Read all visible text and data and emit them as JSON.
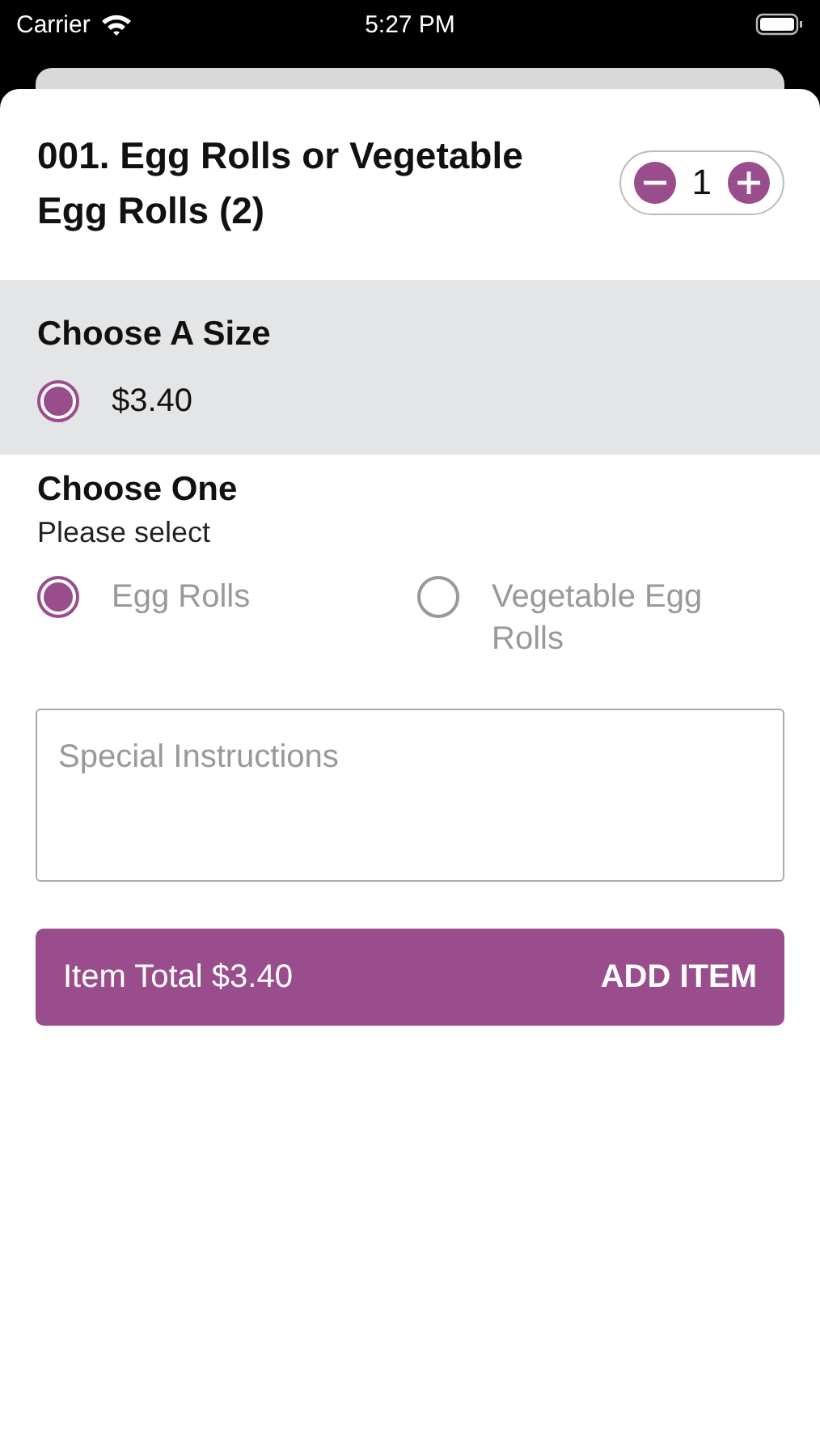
{
  "status_bar": {
    "carrier": "Carrier",
    "time": "5:27 PM"
  },
  "item": {
    "title": "001. Egg Rolls or Vegetable Egg Rolls (2)",
    "quantity": "1"
  },
  "size_section": {
    "heading": "Choose A Size",
    "options": [
      {
        "label": "$3.40",
        "selected": true
      }
    ]
  },
  "choice_section": {
    "heading": "Choose One",
    "subtitle": "Please select",
    "options": [
      {
        "label": "Egg Rolls",
        "selected": true
      },
      {
        "label": "Vegetable Egg Rolls",
        "selected": false
      }
    ]
  },
  "instructions": {
    "placeholder": "Special Instructions"
  },
  "add_bar": {
    "total": "Item Total $3.40",
    "action": "ADD ITEM"
  }
}
